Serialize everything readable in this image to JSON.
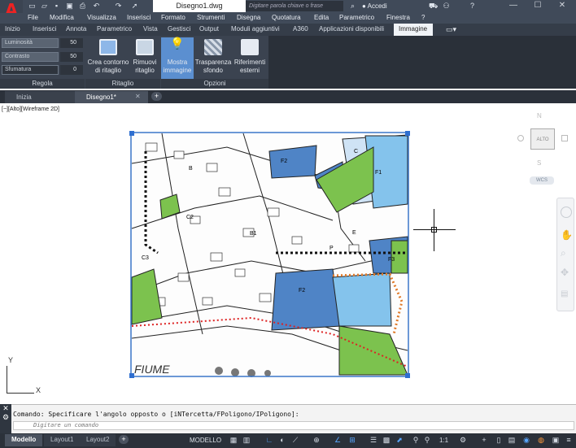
{
  "app": {
    "document_title": "Disegno1.dwg",
    "search_placeholder": "Digitare parola chiave o frase",
    "sign_in": "Accedi"
  },
  "menu": [
    "File",
    "Modifica",
    "Visualizza",
    "Inserisci",
    "Formato",
    "Strumenti",
    "Disegna",
    "Quotatura",
    "Edita",
    "Parametrico",
    "Finestra",
    "?"
  ],
  "ribbon_tabs": [
    "Inizio",
    "Inserisci",
    "Annota",
    "Parametrico",
    "Vista",
    "Gestisci",
    "Output",
    "Moduli aggiuntivi",
    "A360",
    "Applicazioni disponibili",
    "Immagine"
  ],
  "ribbon": {
    "regola": {
      "title": "Regola",
      "luminosita_label": "Luminosità",
      "luminosita_value": "50",
      "contrasto_label": "Contrasto",
      "contrasto_value": "50",
      "sfumatura_label": "Sfumatura",
      "sfumatura_value": "0"
    },
    "ritaglio": {
      "title": "Ritaglio",
      "crea_label_1": "Crea contorno",
      "crea_label_2": "di ritaglio",
      "rimuovi_label_1": "Rimuovi",
      "rimuovi_label_2": "ritaglio"
    },
    "opzioni": {
      "title": "Opzioni",
      "mostra_label_1": "Mostra",
      "mostra_label_2": "immagine",
      "trasparenza_label_1": "Trasparenza",
      "trasparenza_label_2": "sfondo",
      "riferimenti_label_1": "Riferimenti",
      "riferimenti_label_2": "esterni"
    }
  },
  "doc_tabs": [
    "Inizia",
    "Disegno1*"
  ],
  "viewport_label": "[−][Alto][Wireframe 2D]",
  "viewcube": {
    "north": "N",
    "south": "S",
    "face": "ALTO",
    "wcs": "WCS"
  },
  "map_labels": [
    "F2",
    "F1",
    "C",
    "B",
    "C2",
    "B1",
    "F2",
    "C3",
    "P",
    "E",
    "F3"
  ],
  "map_bottom_text": "FIUME",
  "ucs": {
    "x": "X",
    "y": "Y"
  },
  "command": {
    "history": "Comando: Specificare l'angolo opposto o [iNTercetta/FPoligono/IPoligono]:",
    "prompt_placeholder": "Digitare un comando"
  },
  "layout_tabs": [
    "Modello",
    "Layout1",
    "Layout2"
  ],
  "status": {
    "model": "MODELLO",
    "scale": "1:1"
  },
  "colors": {
    "accent": "#4a90d9",
    "ribbon": "#3b4350",
    "titlebar": "#404a59"
  }
}
